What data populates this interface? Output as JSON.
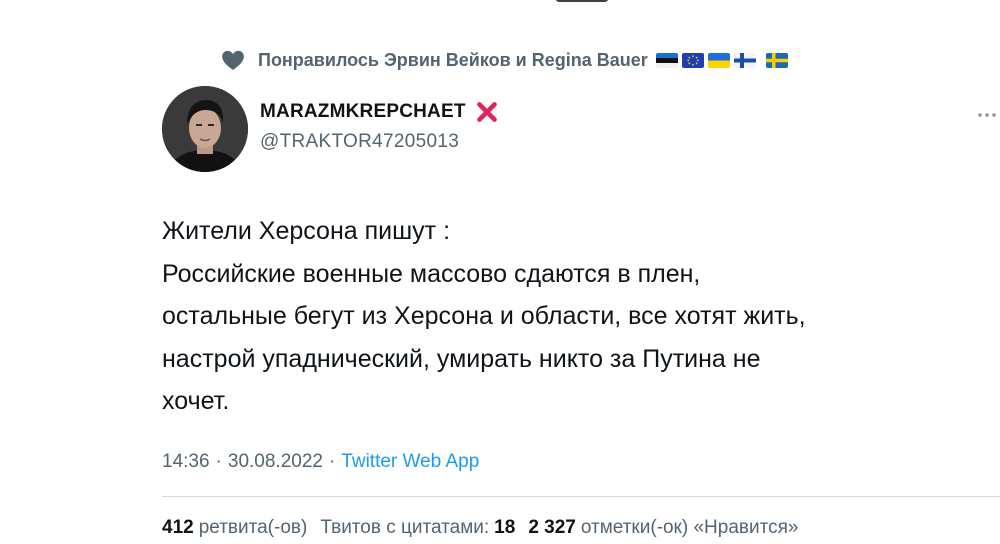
{
  "social_context": {
    "text": "Понравилось Эрвин Вейков и Regina Bauer",
    "flags": [
      "estonia-flag",
      "eu-flag",
      "ukraine-flag",
      "finland-flag",
      "sweden-flag"
    ],
    "heart_color": "#536471"
  },
  "author": {
    "name": "MARAZMKREPCHAET",
    "badge_icon": "red-cross-mark-icon",
    "handle": "@TRAKTOR47205013"
  },
  "tweet": {
    "text": "Жители  Херсона пишут :\nРоссийские  военные массово сдаются в плен,\nостальные бегут из Херсона и области, все хотят жить,\nнастрой упаднический, умирать никто за Путина не\nхочет."
  },
  "meta": {
    "time": "14:36",
    "separator": "·",
    "date": "30.08.2022",
    "source": "Twitter Web App"
  },
  "stats": {
    "retweets_count": "412",
    "retweets_label": "ретвита(-ов)",
    "quotes_label": "Твитов с цитатами:",
    "quotes_count": "18",
    "likes_count": "2 327",
    "likes_label": "отметки(-ок) «Нравится»"
  },
  "colors": {
    "text_primary": "#0f1419",
    "text_secondary": "#536471",
    "link": "#1d9bf0",
    "divider": "#cfd9de",
    "badge_red": "#e0245e"
  }
}
